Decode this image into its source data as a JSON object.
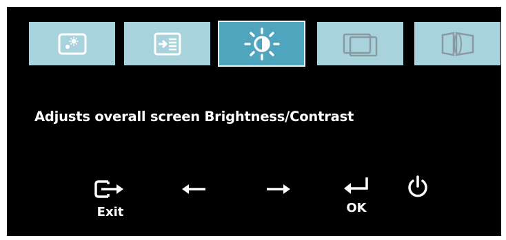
{
  "osd": {
    "tabs": [
      {
        "name": "image-settings-icon",
        "active": false
      },
      {
        "name": "input-signal-icon",
        "active": false
      },
      {
        "name": "brightness-icon",
        "active": true
      },
      {
        "name": "image-position-icon",
        "active": false
      },
      {
        "name": "image-properties-icon",
        "active": false
      }
    ],
    "description": "Adjusts overall screen Brightness/Contrast",
    "buttons": {
      "exit": {
        "label": "Exit",
        "icon": "exit-icon"
      },
      "left": {
        "icon": "arrow-left-icon"
      },
      "right": {
        "icon": "arrow-right-icon"
      },
      "ok": {
        "label": "OK",
        "icon": "enter-icon"
      },
      "power": {
        "icon": "power-icon"
      }
    },
    "colors": {
      "background": "#000000",
      "tab_inactive": "#a8d3dd",
      "tab_active": "#4ea5bd",
      "icon_stroke": "#ffffff",
      "text": "#ffffff"
    }
  }
}
